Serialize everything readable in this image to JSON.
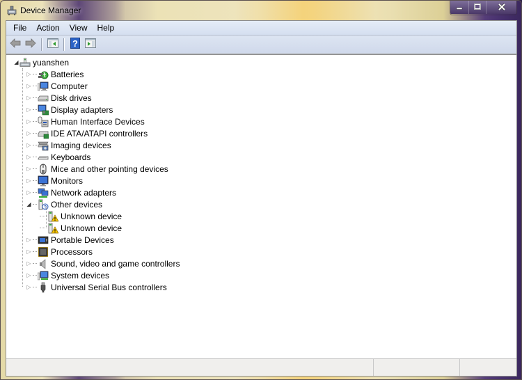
{
  "window": {
    "title": "Device Manager",
    "icon": "device-manager-icon",
    "controls": {
      "minimize": "minimize",
      "maximize": "maximize",
      "close": "close"
    }
  },
  "menu": {
    "items": [
      {
        "label": "File"
      },
      {
        "label": "Action"
      },
      {
        "label": "View"
      },
      {
        "label": "Help"
      }
    ]
  },
  "toolbar": {
    "buttons": [
      {
        "name": "back",
        "icon": "arrow-left-icon"
      },
      {
        "name": "forward",
        "icon": "arrow-right-icon"
      },
      {
        "name": "show-hide-console-tree",
        "icon": "console-tree-icon"
      },
      {
        "name": "help",
        "icon": "help-icon",
        "glyph": "?"
      },
      {
        "name": "show-hide-action-pane",
        "icon": "action-pane-icon"
      }
    ]
  },
  "tree": {
    "root": {
      "label": "yuanshen",
      "expanded": true,
      "icon": "computer-network-icon"
    },
    "items": [
      {
        "label": "Batteries",
        "icon": "battery-icon",
        "expanded": false
      },
      {
        "label": "Computer",
        "icon": "computer-icon",
        "expanded": false
      },
      {
        "label": "Disk drives",
        "icon": "disk-drive-icon",
        "expanded": false
      },
      {
        "label": "Display adapters",
        "icon": "display-adapter-icon",
        "expanded": false
      },
      {
        "label": "Human Interface Devices",
        "icon": "hid-icon",
        "expanded": false
      },
      {
        "label": "IDE ATA/ATAPI controllers",
        "icon": "ide-controller-icon",
        "expanded": false
      },
      {
        "label": "Imaging devices",
        "icon": "imaging-device-icon",
        "expanded": false
      },
      {
        "label": "Keyboards",
        "icon": "keyboard-icon",
        "expanded": false
      },
      {
        "label": "Mice and other pointing devices",
        "icon": "mouse-icon",
        "expanded": false
      },
      {
        "label": "Monitors",
        "icon": "monitor-icon",
        "expanded": false
      },
      {
        "label": "Network adapters",
        "icon": "network-adapter-icon",
        "expanded": false
      },
      {
        "label": "Other devices",
        "icon": "other-devices-icon",
        "expanded": true,
        "children": [
          {
            "label": "Unknown device",
            "icon": "unknown-device-warning-icon"
          },
          {
            "label": "Unknown device",
            "icon": "unknown-device-warning-icon"
          }
        ]
      },
      {
        "label": "Portable Devices",
        "icon": "portable-device-icon",
        "expanded": false
      },
      {
        "label": "Processors",
        "icon": "processor-icon",
        "expanded": false
      },
      {
        "label": "Sound, video and game controllers",
        "icon": "speaker-icon",
        "expanded": false
      },
      {
        "label": "System devices",
        "icon": "system-device-icon",
        "expanded": false
      },
      {
        "label": "Universal Serial Bus controllers",
        "icon": "usb-icon",
        "expanded": false
      }
    ]
  },
  "statusbar": {
    "panes": [
      "",
      "",
      ""
    ]
  }
}
